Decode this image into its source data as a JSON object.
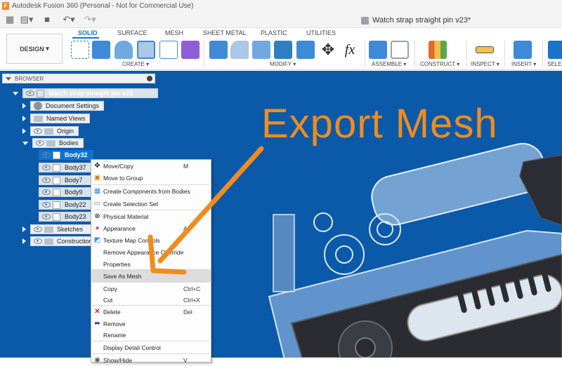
{
  "window": {
    "title": "Autodesk Fusion 360 (Personal - Not for Commercial Use)",
    "document_tab": "Watch strap straight pin v23*"
  },
  "ribbon": {
    "workspace": "DESIGN",
    "tabs": [
      "SOLID",
      "SURFACE",
      "MESH",
      "SHEET METAL",
      "PLASTIC",
      "UTILITIES"
    ],
    "active_tab": "SOLID",
    "groups": [
      "CREATE",
      "MODIFY",
      "ASSEMBLE",
      "CONSTRUCT",
      "INSPECT",
      "INSERT",
      "SELEC"
    ]
  },
  "browser": {
    "title": "BROWSER",
    "root": "Watch strap straight pin v23",
    "items": [
      {
        "label": "Document Settings"
      },
      {
        "label": "Named Views"
      },
      {
        "label": "Origin"
      },
      {
        "label": "Bodies"
      }
    ],
    "bodies": [
      "Body32",
      "Body37",
      "Body7",
      "Body9",
      "Body22",
      "Body23"
    ],
    "after": [
      {
        "label": "Sketches"
      },
      {
        "label": "Construction"
      }
    ]
  },
  "context_menu": {
    "items": [
      {
        "label": "Move/Copy",
        "shortcut": "M"
      },
      {
        "label": "Move to Group",
        "shortcut": ""
      },
      {
        "label": "Create Components from Bodies",
        "shortcut": ""
      },
      {
        "label": "Create Selection Set",
        "shortcut": ""
      },
      {
        "label": "Physical Material",
        "shortcut": ""
      },
      {
        "label": "Appearance",
        "shortcut": "A"
      },
      {
        "label": "Texture Map Controls",
        "shortcut": ""
      },
      {
        "label": "Remove Appearance Override",
        "shortcut": ""
      },
      {
        "label": "Properties",
        "shortcut": ""
      },
      {
        "label": "Save As Mesh",
        "shortcut": ""
      },
      {
        "label": "Copy",
        "shortcut": "Ctrl+C"
      },
      {
        "label": "Cut",
        "shortcut": "Ctrl+X"
      },
      {
        "label": "Delete",
        "shortcut": "Del"
      },
      {
        "label": "Remove",
        "shortcut": ""
      },
      {
        "label": "Rename",
        "shortcut": ""
      },
      {
        "label": "Display Detail Control",
        "shortcut": ""
      },
      {
        "label": "Show/Hide",
        "shortcut": "V"
      }
    ],
    "highlighted": "Save As Mesh"
  },
  "annotation": {
    "headline": "Export Mesh",
    "color": "#f08c1e"
  },
  "colors": {
    "canvas": "#0a5aa9",
    "accent": "#1a73c8",
    "selection": "#0e71d1"
  }
}
